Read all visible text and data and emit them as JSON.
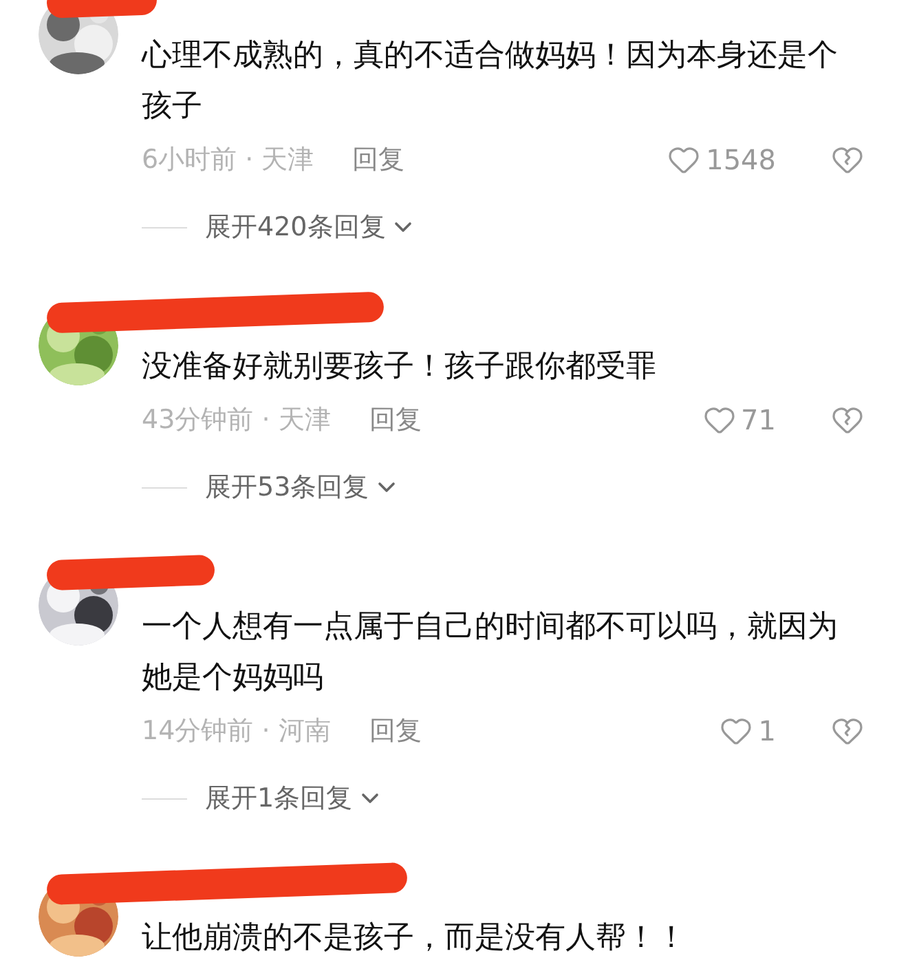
{
  "comments": [
    {
      "text": "心理不成熟的，真的不适合做妈妈！因为本身还是个孩子",
      "meta": "6小时前 · 天津",
      "reply": "回复",
      "likes": "1548",
      "expand": "展开420条回复"
    },
    {
      "text": "没准备好就别要孩子！孩子跟你都受罪",
      "meta": "43分钟前 · 天津",
      "reply": "回复",
      "likes": "71",
      "expand": "展开53条回复"
    },
    {
      "text": "一个人想有一点属于自己的时间都不可以吗，就因为她是个妈妈吗",
      "meta": "14分钟前 · 河南",
      "reply": "回复",
      "likes": "1",
      "expand": "展开1条回复"
    },
    {
      "text": "让他崩溃的不是孩子，而是没有人帮！！"
    }
  ]
}
